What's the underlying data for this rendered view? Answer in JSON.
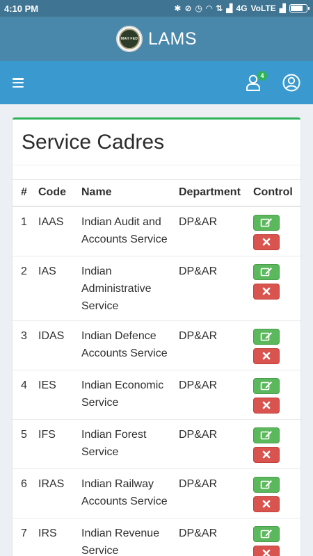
{
  "status_bar": {
    "time": "4:10 PM",
    "network": "4G",
    "volte": "VoLTE"
  },
  "header": {
    "logo_text": "MAH FED",
    "app_title": "LAMS"
  },
  "nav": {
    "notification_count": "4"
  },
  "card": {
    "title": "Service Cadres"
  },
  "table": {
    "headers": {
      "num": "#",
      "code": "Code",
      "name": "Name",
      "department": "Department",
      "control": "Control"
    },
    "rows": [
      {
        "num": "1",
        "code": "IAAS",
        "name": "Indian Audit and Accounts Service",
        "department": "DP&AR"
      },
      {
        "num": "2",
        "code": "IAS",
        "name": "Indian Administrative Service",
        "department": "DP&AR"
      },
      {
        "num": "3",
        "code": "IDAS",
        "name": "Indian Defence Accounts Service",
        "department": "DP&AR"
      },
      {
        "num": "4",
        "code": "IES",
        "name": "Indian Economic Service",
        "department": "DP&AR"
      },
      {
        "num": "5",
        "code": "IFS",
        "name": "Indian Forest Service",
        "department": "DP&AR"
      },
      {
        "num": "6",
        "code": "IRAS",
        "name": "Indian Railway Accounts Service",
        "department": "DP&AR"
      },
      {
        "num": "7",
        "code": "IRS",
        "name": "Indian Revenue Service",
        "department": "DP&AR"
      }
    ]
  },
  "colors": {
    "status_bar": "#3f7592",
    "brand_bar": "#4a88ab",
    "nav_bar": "#3a9ad0",
    "accent_green": "#2fb35a",
    "edit_button": "#5cb85c",
    "delete_button": "#d9534f"
  },
  "icons": {
    "menu": "hamburger-icon",
    "notifications": "user-icon",
    "profile": "profile-circle-icon",
    "edit": "edit-icon",
    "delete": "close-icon"
  }
}
